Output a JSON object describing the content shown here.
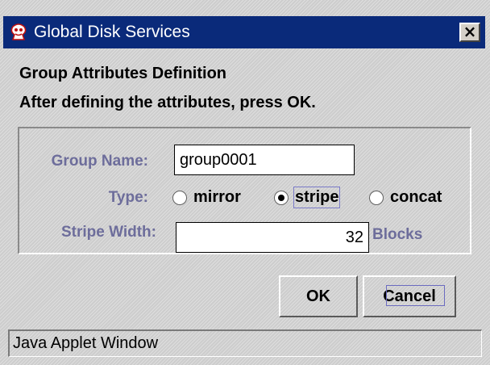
{
  "window": {
    "title": "Global Disk Services",
    "app_icon": "java-applet-icon",
    "close_glyph": "×"
  },
  "header": {
    "line1": "Group Attributes Definition",
    "line2": "After defining the attributes, press OK."
  },
  "form": {
    "group_name_label": "Group Name:",
    "group_name_value": "group0001",
    "type_label": "Type:",
    "type_options": [
      {
        "label": "mirror",
        "selected": false
      },
      {
        "label": "stripe",
        "selected": true
      },
      {
        "label": "concat",
        "selected": false
      }
    ],
    "stripe_width_label": "Stripe Width:",
    "stripe_width_value": "32",
    "stripe_width_unit": "Blocks"
  },
  "buttons": {
    "ok": "OK",
    "cancel": "Cancel"
  },
  "status": {
    "text": "Java Applet Window"
  },
  "colors": {
    "titlebar": "#0a2a7a",
    "label": "#6d6d9b",
    "window_bg": "#cdcdcd"
  }
}
